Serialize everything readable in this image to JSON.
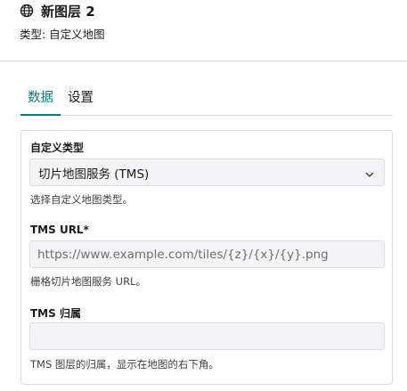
{
  "header": {
    "title": "新图层 2",
    "subtitle": "类型: 自定义地图",
    "icon": "globe-icon"
  },
  "tabs": [
    {
      "label": "数据",
      "active": true
    },
    {
      "label": "设置",
      "active": false
    }
  ],
  "form": {
    "custom_type": {
      "label": "自定义类型",
      "value": "切片地图服务 (TMS)",
      "help": "选择自定义地图类型。"
    },
    "tms_url": {
      "label": "TMS URL*",
      "value": "",
      "placeholder": "https://www.example.com/tiles/{z}/{x}/{y}.png",
      "help": "栅格切片地图服务 URL。"
    },
    "tms_attribution": {
      "label": "TMS 归属",
      "value": "",
      "placeholder": "",
      "help": "TMS 图层的归属，显示在地图的右下角。"
    }
  },
  "colors": {
    "accent": "#0d7a7a",
    "border": "#d8dadd",
    "input_bg": "#f3f4f5"
  }
}
